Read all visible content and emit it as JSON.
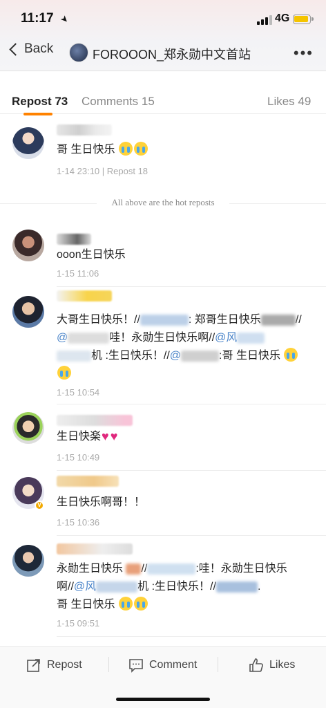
{
  "status": {
    "time": "11:17",
    "network": "4G",
    "accent": "#ff8200"
  },
  "nav": {
    "back_label": "Back",
    "title": "FOROOON_郑永勋中文首站",
    "more": "•••"
  },
  "tabs": [
    {
      "label": "Repost 73",
      "active": true
    },
    {
      "label": "Comments 15",
      "active": false
    },
    {
      "label": "Likes 49",
      "active": false
    }
  ],
  "hot_divider": "All above are the hot reposts",
  "hot_repost": {
    "text": "哥 生日快乐",
    "meta": "1-14 23:10 | Repost 18"
  },
  "reposts": [
    {
      "text": "ooon生日快乐",
      "time": "1-15 11:06"
    },
    {
      "text_a": "大哥生日快乐！//",
      "text_b": ": 郑哥生日快乐",
      "text_c": "//",
      "text_d": "@",
      "text_e": "哇！永勋生日快乐啊//",
      "text_f": "@风",
      "text_g": "机 :生日快乐！//",
      "text_h": "@",
      "text_i": ":哥 生日快乐",
      "time": "1-15 10:54"
    },
    {
      "text": "生日快楽",
      "time": "1-15 10:49"
    },
    {
      "text": "生日快乐啊哥！！",
      "time": "1-15 10:36"
    },
    {
      "text_a": "永勋生日快乐",
      "text_b": "//",
      "text_c": ":哇！永勋生日快乐",
      "text_d": "啊//",
      "text_e": "@风",
      "text_f": "机 :生日快乐！//",
      "text_g": "@",
      "text_h": ".",
      "text_i": "哥 生日快乐",
      "time": "1-15 09:51"
    }
  ],
  "bottom": {
    "repost": "Repost",
    "comment": "Comment",
    "likes": "Likes"
  }
}
